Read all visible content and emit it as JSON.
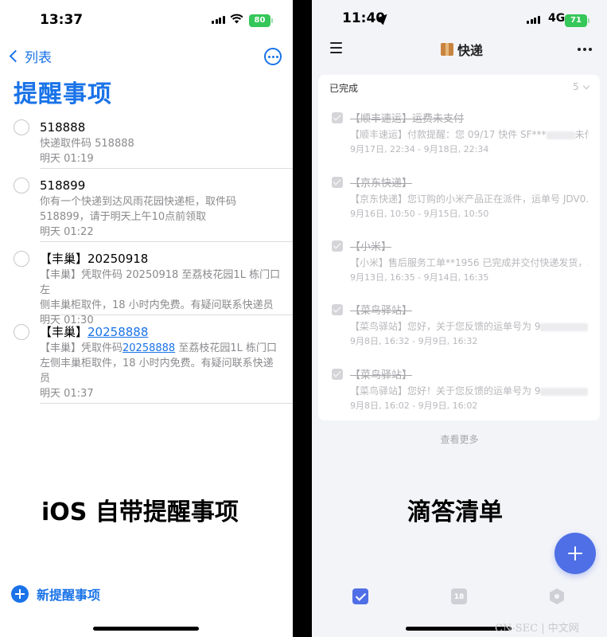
{
  "left_phone": {
    "status_time": "13:37",
    "battery": "80",
    "back_label": "列表",
    "list_title": "提醒事项",
    "reminders": [
      {
        "title": "518888",
        "note": "快递取件码 518888",
        "due": "明天 01:19"
      },
      {
        "title": "518899",
        "note_lines": [
          "你有一个快递到达风雨花园快递柜，取件码",
          "518899，请于明天上午10点前领取"
        ],
        "due": "明天 01:22"
      },
      {
        "title": "【丰巢】20250918",
        "note_lines": [
          "【丰巢】凭取件码 20250918 至荔枝花园1L 栋门口左",
          "侧丰巢柜取件，18 小时内免费。有疑问联系快递员"
        ],
        "due": "明天 01:30"
      },
      {
        "title_prefix": "【丰巢】",
        "title_link": "20258888",
        "note_prefix": "【丰巢】凭取件码",
        "note_link": "20258888",
        "note_rest": " 至荔枝花园1L 栋门口",
        "note_lines": [
          "左侧丰巢柜取件，18 小时内免费。有疑问联系快递",
          "员"
        ],
        "due": "明天 01:37"
      }
    ],
    "caption": "iOS 自带提醒事项",
    "new_reminder_label": "新提醒事项"
  },
  "right_phone": {
    "status_time": "11:40",
    "network": "4G",
    "battery": "71",
    "list_title": "快递",
    "completed_header": "已完成",
    "completed_count": "5",
    "tasks": [
      {
        "title": "【顺丰速运】运费未支付",
        "note": "【顺丰速运】付款提醒：您 09/17 快件 SF***",
        "note_end": "未付...",
        "date": "9月17日, 22:34 - 9月18日, 22:34"
      },
      {
        "title": "【京东快递】",
        "note": "【京东快递】您订购的小米产品正在派件，运单号 JDV0...",
        "date": "9月16日, 10:50 - 9月15日, 10:50"
      },
      {
        "title": "【小米】",
        "note": "【小米】售后服务工单**1956 已完成并交付快递发货，...",
        "date": "9月13日, 16:35 - 9月14日, 16:35"
      },
      {
        "title": "【菜鸟驿站】",
        "note": "【菜鸟驿站】您好，关于您反馈的运单号为 9",
        "note_end": "...",
        "date": "9月8日, 16:32 - 9月9日, 16:32"
      },
      {
        "title": "【菜鸟驿站】",
        "note": "【菜鸟驿站】您好！关于您反馈的运单号为 9",
        "note_end": "...",
        "date": "9月8日, 16:02 - 9月9日, 16:02"
      }
    ],
    "see_more": "查看更多",
    "caption": "滴答清单",
    "calendar_tab_day": "18"
  },
  "watermark": "CN-SEC | 中文网"
}
